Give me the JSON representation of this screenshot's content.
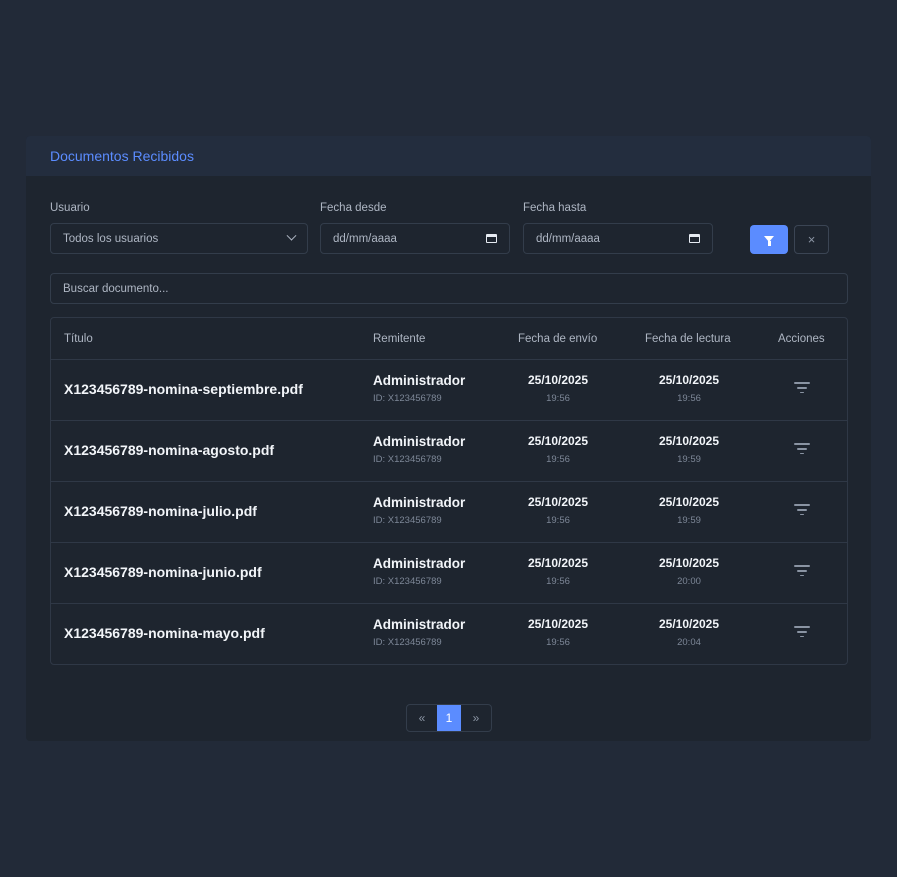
{
  "panel": {
    "title": "Documentos Recibidos"
  },
  "filters": {
    "user_label": "Usuario",
    "user_value": "Todos los usuarios",
    "from_label": "Fecha desde",
    "from_value": "dd/mm/aaaa",
    "to_label": "Fecha hasta",
    "to_value": "dd/mm/aaaa",
    "clear_label": "×"
  },
  "search": {
    "placeholder": "Buscar documento..."
  },
  "table": {
    "headers": [
      "Título",
      "Remitente",
      "Fecha de envío",
      "Fecha de lectura",
      "Acciones"
    ],
    "rows": [
      {
        "title": "X123456789-nomina-septiembre.pdf",
        "sender": "Administrador",
        "sender_id": "ID: X123456789",
        "sent_date": "25/10/2025",
        "sent_time": "19:56",
        "read_date": "25/10/2025",
        "read_time": "19:56"
      },
      {
        "title": "X123456789-nomina-agosto.pdf",
        "sender": "Administrador",
        "sender_id": "ID: X123456789",
        "sent_date": "25/10/2025",
        "sent_time": "19:56",
        "read_date": "25/10/2025",
        "read_time": "19:59"
      },
      {
        "title": "X123456789-nomina-julio.pdf",
        "sender": "Administrador",
        "sender_id": "ID: X123456789",
        "sent_date": "25/10/2025",
        "sent_time": "19:56",
        "read_date": "25/10/2025",
        "read_time": "19:59"
      },
      {
        "title": "X123456789-nomina-junio.pdf",
        "sender": "Administrador",
        "sender_id": "ID: X123456789",
        "sent_date": "25/10/2025",
        "sent_time": "19:56",
        "read_date": "25/10/2025",
        "read_time": "20:00"
      },
      {
        "title": "X123456789-nomina-mayo.pdf",
        "sender": "Administrador",
        "sender_id": "ID: X123456789",
        "sent_date": "25/10/2025",
        "sent_time": "19:56",
        "read_date": "25/10/2025",
        "read_time": "20:04"
      }
    ]
  },
  "pagination": {
    "prev": "«",
    "current": "1",
    "next": "»"
  }
}
